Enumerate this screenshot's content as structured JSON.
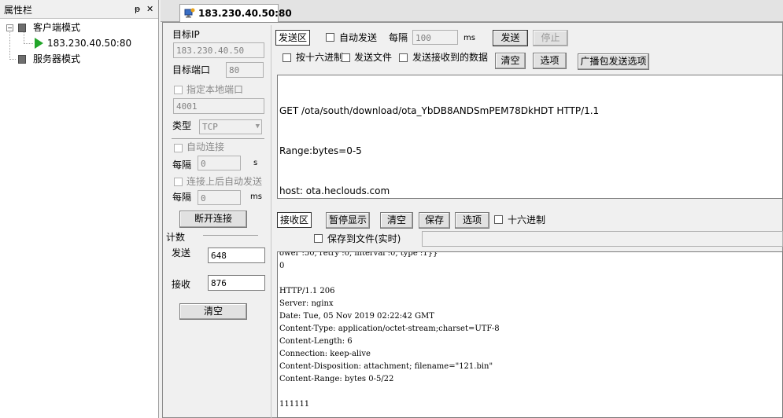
{
  "tree": {
    "header_title": "属性栏",
    "pin_glyph": "ᵽ",
    "close_glyph": "✕",
    "expander_glyph": "−",
    "client_mode_label": "客户端模式",
    "connection_label": "183.230.40.50:80",
    "server_mode_label": "服务器模式"
  },
  "tab": {
    "title": "183.230.40.50:80"
  },
  "left_panel": {
    "target_ip_label": "目标IP",
    "target_ip_value": "183.230.40.50",
    "target_port_label": "目标端口",
    "target_port_value": "80",
    "local_port_label": "指定本地端口",
    "local_port_value": "4001",
    "type_label": "类型",
    "type_value": "TCP",
    "auto_connect_label": "自动连接",
    "interval_label": "每隔",
    "interval_value": "0",
    "interval_unit": "s",
    "auto_send_label": "连接上后自动发送",
    "interval2_label": "每隔",
    "interval2_value": "0",
    "interval2_unit": "ms",
    "disconnect_button": "断开连接",
    "count_label": "计数",
    "sent_label": "发送",
    "sent_value": "648",
    "recv_label": "接收",
    "recv_value": "876",
    "clear_button": "清空"
  },
  "send_area": {
    "section_label": "发送区",
    "auto_send_label": "自动发送",
    "interval_label": "每隔",
    "interval_value": "100",
    "interval_unit": "ms",
    "send_button": "发送",
    "stop_button": "停止",
    "hex_label": "按十六进制",
    "send_file_label": "发送文件",
    "send_received_label": "发送接收到的数据",
    "clear_button": "清空",
    "options_button": "选项",
    "broadcast_button": "广播包发送选项",
    "content_lines": [
      "GET /ota/south/download/ota_YbDB8ANDSmPEM78DkHDT HTTP/1.1",
      "Range:bytes=0-5",
      "host: ota.heclouds.com"
    ]
  },
  "recv_area": {
    "section_label": "接收区",
    "pause_button": "暂停显示",
    "clear_button": "清空",
    "save_button": "保存",
    "options_button": "选项",
    "hex_label": "十六进制",
    "save_to_file_label": "保存到文件(实时)",
    "content_lines": [
      "ower :50, retry :0, interval :0, type :1}}",
      "0",
      "",
      "HTTP/1.1 206",
      "Server: nginx",
      "Date: Tue, 05 Nov 2019 02:22:42 GMT",
      "Content-Type: application/octet-stream;charset=UTF-8",
      "Content-Length: 6",
      "Connection: keep-alive",
      "Content-Disposition: attachment; filename=\"121.bin\"",
      "Content-Range: bytes 0-5/22",
      "",
      "111111"
    ]
  },
  "colors": {
    "play_icon": "#22a52a",
    "tab_icon": "#3a6fc4"
  }
}
